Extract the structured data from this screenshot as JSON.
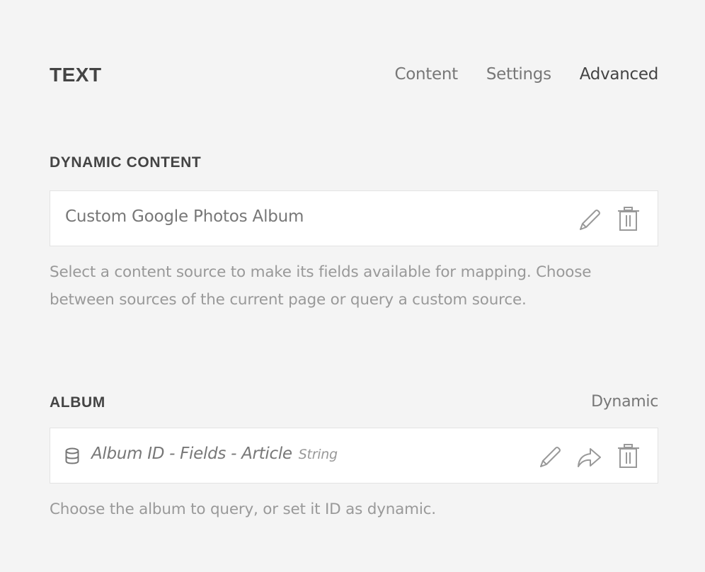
{
  "header": {
    "title": "TEXT",
    "tabs": [
      {
        "label": "Content",
        "active": false
      },
      {
        "label": "Settings",
        "active": false
      },
      {
        "label": "Advanced",
        "active": true
      }
    ]
  },
  "dynamic_content": {
    "label": "DYNAMIC CONTENT",
    "value": "Custom Google Photos Album",
    "actions": [
      "edit-icon",
      "trash-icon"
    ],
    "help_text": "Select a content source to make its fields available for mapping. Choose between sources of the current page or query a custom source."
  },
  "album": {
    "label": "ALBUM",
    "link_label": "Dynamic",
    "field_icon": "database-icon",
    "value": "Album ID - Fields - Article",
    "value_type": "String",
    "actions": [
      "edit-icon",
      "share-icon",
      "trash-icon"
    ],
    "help_text": "Choose the album to query, or set it ID as dynamic."
  },
  "colors": {
    "background": "#f4f4f4",
    "field_background": "#ffffff",
    "field_border": "#e3e3e3",
    "heading": "#444444",
    "muted": "#999999",
    "icon": "#999999"
  }
}
